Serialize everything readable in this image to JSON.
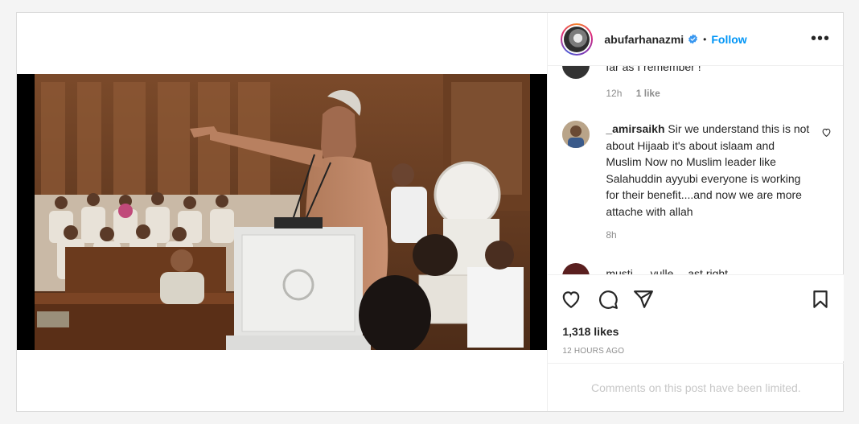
{
  "post": {
    "username": "abufarhanazmi",
    "follow_label": "Follow",
    "separator": "•",
    "more_label": "•••",
    "likes": "1,318 likes",
    "timestamp": "12 HOURS AGO",
    "comments_limited": "Comments on this post have been limited."
  },
  "comments": [
    {
      "text": "far as I remember !",
      "time": "12h",
      "likes": "1 like"
    },
    {
      "username": "_amirsaikh",
      "text": "Sir we understand this is not about Hijaab it's about islaam and Muslim Now no Muslim leader like Salahuddin ayyubi everyone is working for their benefit....and now we are more attache with allah",
      "time": "8h"
    },
    {
      "text": "musti … vulle …ast right"
    }
  ],
  "colors": {
    "accent": "#0095f6",
    "text": "#262626",
    "muted": "#8e8e8e"
  }
}
